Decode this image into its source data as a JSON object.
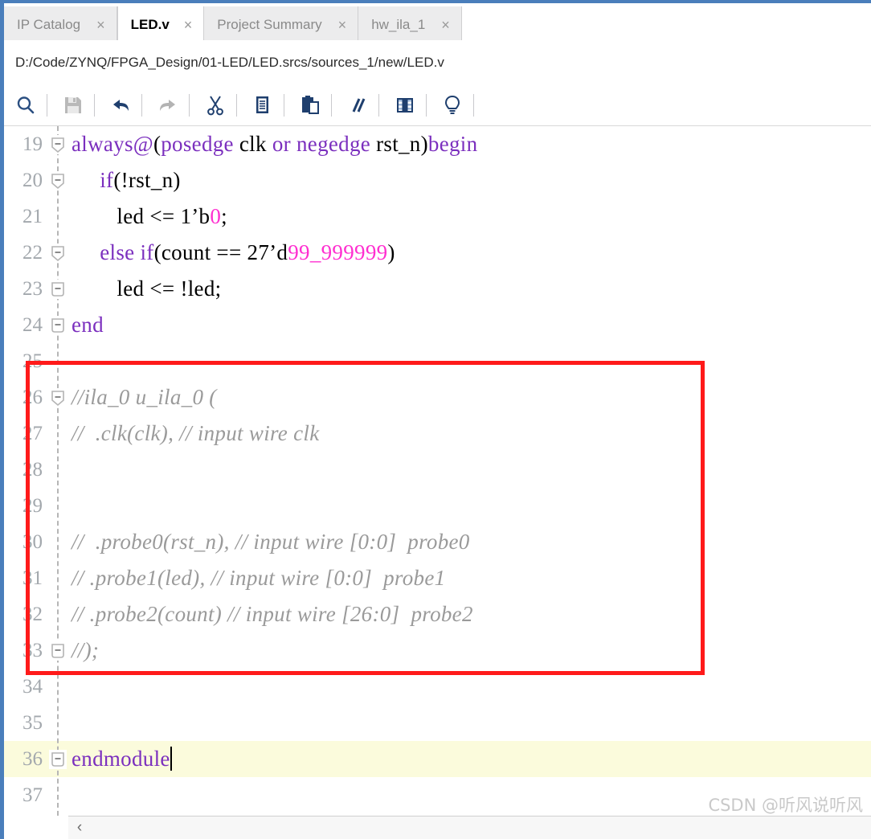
{
  "window": {
    "accent_color": "#4a7ebb",
    "annotation_color": "#ff1a1a"
  },
  "tabs": [
    {
      "label": "IP Catalog",
      "active": false,
      "close": "×"
    },
    {
      "label": "LED.v",
      "active": true,
      "close": "×"
    },
    {
      "label": "Project Summary",
      "active": false,
      "close": "×"
    },
    {
      "label": "hw_ila_1",
      "active": false,
      "close": "×"
    }
  ],
  "path": {
    "text": "D:/Code/ZYNQ/FPGA_Design/01-LED/LED.srcs/sources_1/new/LED.v"
  },
  "toolbar": {
    "items": [
      {
        "name": "find-icon",
        "title": "Find"
      },
      {
        "name": "save-icon",
        "title": "Save File"
      },
      {
        "name": "undo-icon",
        "title": "Undo"
      },
      {
        "name": "redo-icon",
        "title": "Redo"
      },
      {
        "name": "cut-icon",
        "title": "Cut"
      },
      {
        "name": "copy-icon",
        "title": "Copy"
      },
      {
        "name": "paste-icon",
        "title": "Paste"
      },
      {
        "name": "comment-icon",
        "title": "Toggle Comment"
      },
      {
        "name": "table-icon",
        "title": "Show Columns"
      },
      {
        "name": "bulb-icon",
        "title": "Suggestions"
      }
    ]
  },
  "editor": {
    "first_line": 19,
    "lines": [
      {
        "no": "19",
        "fold": "open",
        "text": "always@(posedge clk or negedge rst_n)begin",
        "tokens": [
          {
            "t": "always@",
            "c": "kw"
          },
          {
            "t": "(",
            "c": ""
          },
          {
            "t": "posedge",
            "c": "kw"
          },
          {
            "t": " clk ",
            "c": ""
          },
          {
            "t": "or",
            "c": "kw"
          },
          {
            "t": " ",
            "c": ""
          },
          {
            "t": "negedge",
            "c": "kw"
          },
          {
            "t": " rst_n",
            "c": ""
          },
          {
            "t": ")",
            "c": ""
          },
          {
            "t": "begin",
            "c": "kw"
          }
        ]
      },
      {
        "no": "20",
        "fold": "open",
        "text": "    if(!rst_n)",
        "tokens": [
          {
            "t": "     ",
            "c": ""
          },
          {
            "t": "if",
            "c": "kw"
          },
          {
            "t": "(!rst_n)",
            "c": ""
          }
        ]
      },
      {
        "no": "21",
        "fold": "none",
        "text": "        led <= 1'b0;",
        "tokens": [
          {
            "t": "        led <= 1’b",
            "c": ""
          },
          {
            "t": "0",
            "c": "num"
          },
          {
            "t": ";",
            "c": ""
          }
        ]
      },
      {
        "no": "22",
        "fold": "open",
        "text": "    else if(count == 27'd99_999999)",
        "tokens": [
          {
            "t": "     ",
            "c": ""
          },
          {
            "t": "else",
            "c": "kw"
          },
          {
            "t": " ",
            "c": ""
          },
          {
            "t": "if",
            "c": "kw"
          },
          {
            "t": "(count == 27’d",
            "c": ""
          },
          {
            "t": "99_999999",
            "c": "num"
          },
          {
            "t": ")",
            "c": ""
          }
        ]
      },
      {
        "no": "23",
        "fold": "close",
        "text": "        led <= !led;",
        "tokens": [
          {
            "t": "        led <= !led;",
            "c": ""
          }
        ]
      },
      {
        "no": "24",
        "fold": "close",
        "text": "end",
        "tokens": [
          {
            "t": "end",
            "c": "kw"
          }
        ]
      },
      {
        "no": "25",
        "fold": "none",
        "text": "",
        "tokens": []
      },
      {
        "no": "26",
        "fold": "open",
        "text": "//ila_0 u_ila_0 (",
        "tokens": [
          {
            "t": "//ila_0 u_ila_0 (",
            "c": "cmt"
          }
        ]
      },
      {
        "no": "27",
        "fold": "none",
        "text": "//  .clk(clk), // input wire clk",
        "tokens": [
          {
            "t": "//  .clk(clk), // input wire clk",
            "c": "cmt"
          }
        ]
      },
      {
        "no": "28",
        "fold": "none",
        "text": "",
        "tokens": []
      },
      {
        "no": "29",
        "fold": "none",
        "text": "",
        "tokens": []
      },
      {
        "no": "30",
        "fold": "none",
        "text": "//  .probe0(rst_n), // input wire [0:0]  probe0",
        "tokens": [
          {
            "t": "//  .probe0(rst_n), // input wire [0:0]  probe0",
            "c": "cmt"
          }
        ]
      },
      {
        "no": "31",
        "fold": "none",
        "text": "// .probe1(led), // input wire [0:0]  probe1",
        "tokens": [
          {
            "t": "// .probe1(led), // input wire [0:0]  probe1",
            "c": "cmt"
          }
        ]
      },
      {
        "no": "32",
        "fold": "none",
        "text": "// .probe2(count) // input wire [26:0]  probe2",
        "tokens": [
          {
            "t": "// .probe2(count) // input wire [26:0]  probe2",
            "c": "cmt"
          }
        ]
      },
      {
        "no": "33",
        "fold": "close",
        "text": "//);",
        "tokens": [
          {
            "t": "//);",
            "c": "cmt"
          }
        ]
      },
      {
        "no": "34",
        "fold": "none",
        "text": "",
        "tokens": []
      },
      {
        "no": "35",
        "fold": "none",
        "text": "",
        "tokens": []
      },
      {
        "no": "36",
        "fold": "close",
        "text": "endmodule",
        "highlight": true,
        "caret": true,
        "tokens": [
          {
            "t": "endmodule",
            "c": "kw"
          }
        ]
      },
      {
        "no": "37",
        "fold": "none",
        "text": "",
        "tokens": []
      }
    ]
  },
  "scrollbar": {
    "left_arrow": "‹"
  },
  "watermark": {
    "text": "CSDN @听风说听风"
  }
}
